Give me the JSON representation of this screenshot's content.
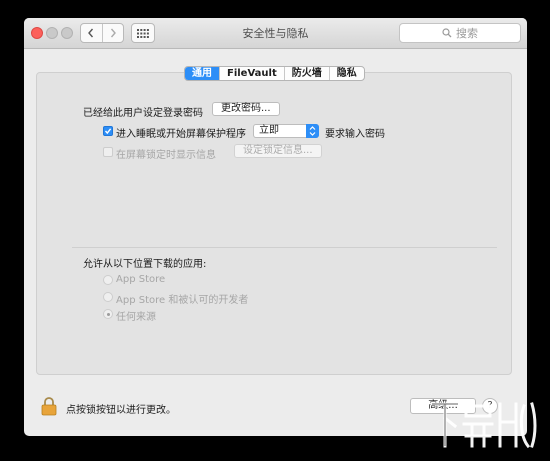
{
  "window": {
    "title": "安全性与隐私",
    "search_placeholder": "搜索"
  },
  "tabs": [
    {
      "label": "通用",
      "active": true
    },
    {
      "label": "FileVault",
      "active": false
    },
    {
      "label": "防火墙",
      "active": false
    },
    {
      "label": "隐私",
      "active": false
    }
  ],
  "general": {
    "password_set_text": "已经给此用户设定登录密码",
    "change_password_button": "更改密码...",
    "require_password": {
      "checked": true,
      "label": "进入睡眠或开始屏幕保护程序",
      "selected_option": "立即",
      "suffix": "要求输入密码"
    },
    "show_message": {
      "checked": false,
      "label": "在屏幕锁定时显示信息",
      "button": "设定锁定信息..."
    }
  },
  "downloads": {
    "heading": "允许从以下位置下载的应用:",
    "options": [
      {
        "label": "App Store",
        "selected": false
      },
      {
        "label": "App Store 和被认可的开发者",
        "selected": false
      },
      {
        "label": "任何来源",
        "selected": true
      }
    ]
  },
  "footer": {
    "lock_text": "点按锁按钮以进行更改。",
    "advanced_button": "高级...",
    "help_button": "?"
  },
  "colors": {
    "accent": "#2d8ef7",
    "lock": "#e8a43a"
  }
}
